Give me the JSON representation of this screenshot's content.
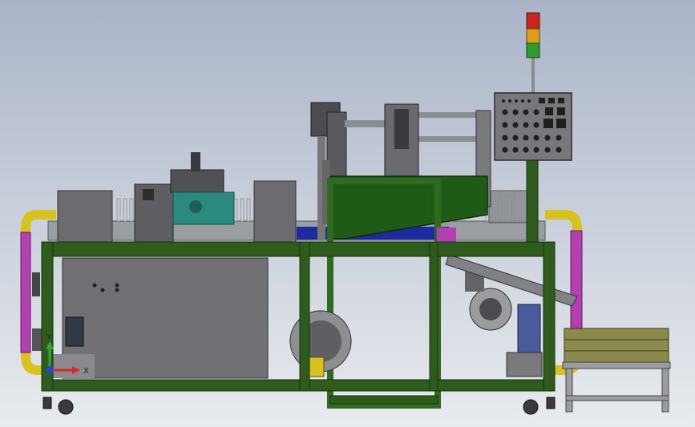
{
  "scene": {
    "title": "",
    "colors": {
      "frame": "#2f5b1c",
      "frame_edge": "#173010",
      "hopper": "#1f5a16",
      "panel_grey": "#6e6e72",
      "cabinet_grey": "#707075",
      "pipe_pink": "#b33fb0",
      "pipe_yellow": "#d7c21f",
      "tank_teal": "#2a8a80",
      "conveyor_blue": "#1c2aa0",
      "crate_olive": "#8b8a4d",
      "light_red": "#c8261f",
      "light_amber": "#d9a21a",
      "light_green": "#2f9a2f"
    },
    "triad": {
      "x_label": "X",
      "y_label": "Y"
    },
    "control_panel": {
      "icon": "control-panel-buttons",
      "rows": 4
    },
    "stack_light": {
      "segments": [
        "red",
        "amber",
        "green"
      ]
    }
  }
}
